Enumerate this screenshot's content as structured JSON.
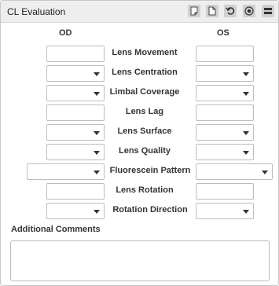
{
  "panel": {
    "title": "CL Evaluation",
    "header_icons": [
      "note-icon",
      "document-icon",
      "undo-icon",
      "record-icon",
      "collapse-icon"
    ]
  },
  "columns": {
    "od": "OD",
    "os": "OS"
  },
  "rows": [
    {
      "label": "Lens Movement",
      "type": "input"
    },
    {
      "label": "Lens Centration",
      "type": "select"
    },
    {
      "label": "Limbal Coverage",
      "type": "select"
    },
    {
      "label": "Lens Lag",
      "type": "input"
    },
    {
      "label": "Lens Surface",
      "type": "select"
    },
    {
      "label": "Lens Quality",
      "type": "select"
    },
    {
      "label": "Fluorescein Pattern",
      "type": "select"
    },
    {
      "label": "Lens Rotation",
      "type": "input"
    },
    {
      "label": "Rotation Direction",
      "type": "select"
    }
  ],
  "additional_comments": {
    "label": "Additional Comments",
    "value": ""
  }
}
